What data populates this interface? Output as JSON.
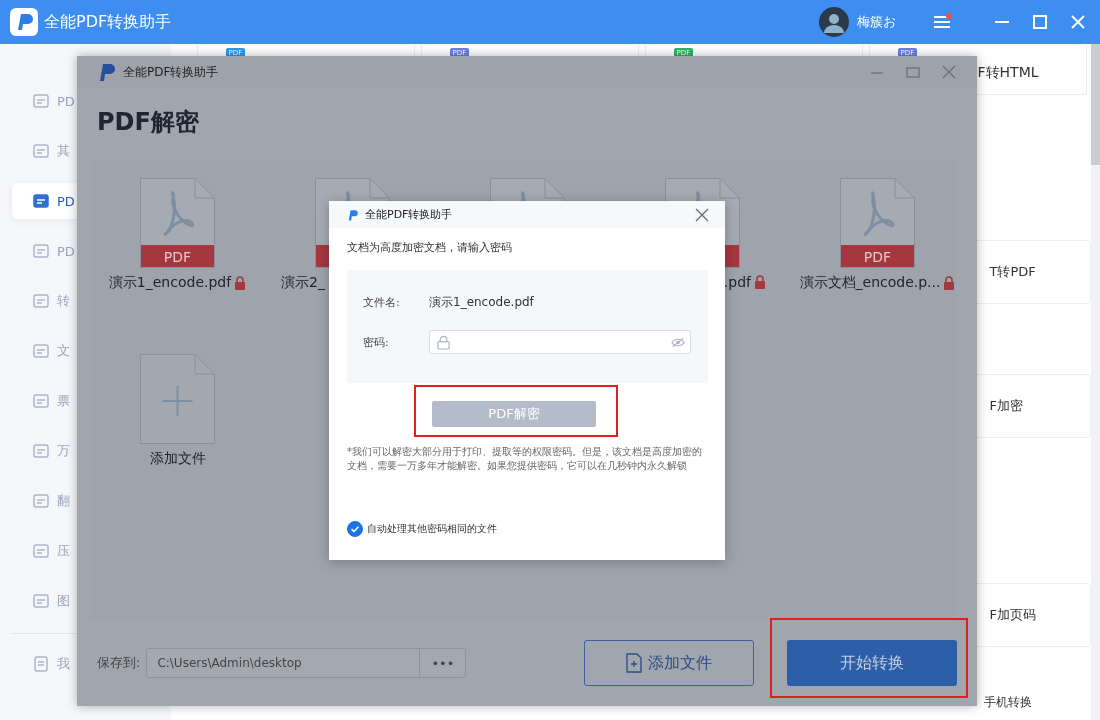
{
  "app": {
    "title": "全能PDF转换助手",
    "user": "梅簇お",
    "menu_badge": true
  },
  "sidebar": {
    "items": [
      {
        "label": "PD",
        "selected": false
      },
      {
        "label": "其",
        "selected": false
      },
      {
        "label": "PD",
        "selected": true
      },
      {
        "label": "PD",
        "selected": false
      },
      {
        "label": "转",
        "selected": false
      },
      {
        "label": "文",
        "selected": false
      },
      {
        "label": "票",
        "selected": false
      },
      {
        "label": "万",
        "selected": false
      },
      {
        "label": "翻",
        "selected": false
      },
      {
        "label": "压",
        "selected": false
      },
      {
        "label": "图",
        "selected": false
      }
    ],
    "footer": "我"
  },
  "content": {
    "top_cards": [
      {
        "badge": "PDF",
        "color": "#2f9bf0"
      },
      {
        "badge": "PDF",
        "color": "#6f7fe0"
      },
      {
        "badge": "PDF",
        "color": "#2fb36a"
      },
      {
        "badge": "PDF",
        "color": "#6f7fe0",
        "label": "F转HTML"
      }
    ],
    "side_cards": [
      "T转PDF",
      "F加密",
      "F加页码"
    ],
    "footer_link": "手机转换"
  },
  "window": {
    "title": "全能PDF转换助手",
    "heading": "PDF解密",
    "files": [
      {
        "kind": "pdf",
        "band": "PDF",
        "name": "演示1_encode.pdf",
        "locked": true
      },
      {
        "kind": "pdf",
        "name": "演示2_"
      },
      {
        "kind": "pdf"
      },
      {
        "kind": "pdf",
        "name": ".pdf",
        "locked": true
      },
      {
        "kind": "pdf",
        "band": "PDF",
        "name": "演示文档_encode.p...",
        "locked": true
      }
    ],
    "add_tile": "添加文件",
    "save_label": "保存到:",
    "save_path": "C:\\Users\\Admin\\desktop",
    "browse": "•••",
    "add_button": "添加文件",
    "start_button": {
      "label": "开始转换",
      "annotated": true
    }
  },
  "dialog": {
    "title": "全能PDF转换助手",
    "prompt": "文档为高度加密文档，请输入密码",
    "file_label": "文件名:",
    "file_name": "演示1_encode.pdf",
    "password_label": "密码:",
    "decrypt_button": {
      "label": "PDF解密",
      "disabled": true,
      "annotated": true
    },
    "note": "*我们可以解密大部分用于打印、提取等的权限密码。但是，该文档是高度加密的文档，需要一万多年才能解密。如果您提供密码，它可以在几秒钟内永久解锁",
    "checkbox": {
      "label": "自动处理其他密码相同的文件",
      "checked": true
    }
  }
}
